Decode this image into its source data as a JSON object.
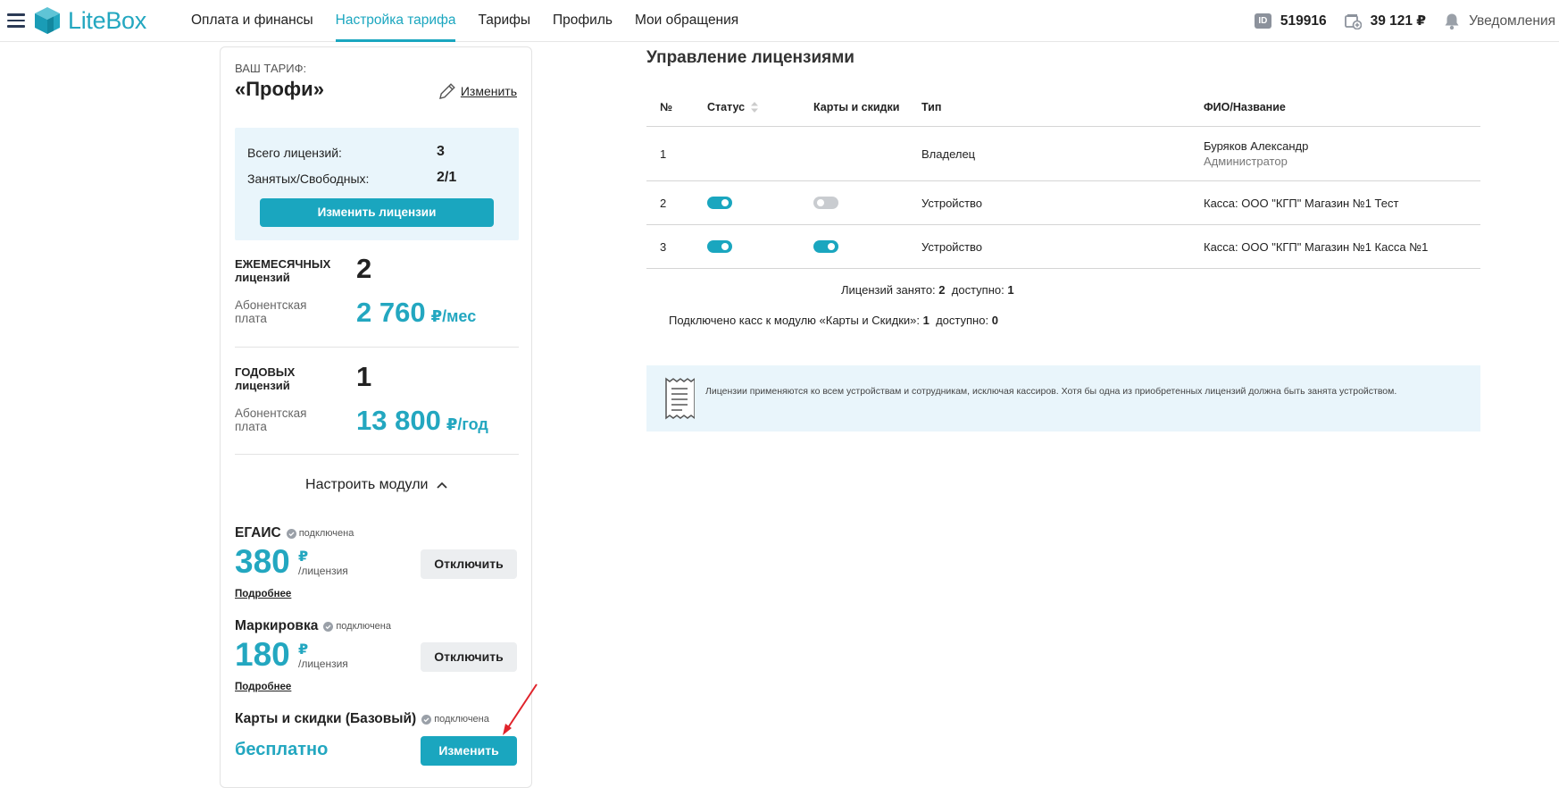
{
  "app": {
    "logo_text": "LiteBox"
  },
  "nav": [
    "Оплата и финансы",
    "Настройка тарифа",
    "Тарифы",
    "Профиль",
    "Мои обращения"
  ],
  "topright": {
    "id_badge": "ID",
    "account_id": "519916",
    "balance": "39 121 ₽",
    "notifications": "Уведомления"
  },
  "tariff": {
    "caption": "ВАШ ТАРИФ:",
    "name": "«Профи»",
    "edit_label": "Изменить",
    "total_label": "Всего лицензий:",
    "total_value": "3",
    "used_label": "Занятых/Свободных:",
    "used_value": "2/1",
    "change_licenses_label": "Изменить лицензии",
    "monthly": {
      "title": "ЕЖЕМЕСЯЧНЫХ лицензий",
      "count": "2",
      "fee_label": "Абонентская плата",
      "fee_value": "2 760",
      "fee_unit": "₽/мес"
    },
    "yearly": {
      "title": "ГОДОВЫХ лицензий",
      "count": "1",
      "fee_label": "Абонентская плата",
      "fee_value": "13 800",
      "fee_unit": "₽/год"
    },
    "modules_toggle": "Настроить модули",
    "modules": [
      {
        "name": "ЕГАИС",
        "status": "подключена",
        "price": "380",
        "currency": "₽",
        "per": "/лицензия",
        "more": "Подробнее",
        "action": "Отключить"
      },
      {
        "name": "Маркировка",
        "status": "подключена",
        "price": "180",
        "currency": "₽",
        "per": "/лицензия",
        "more": "Подробнее",
        "action": "Отключить"
      },
      {
        "name": "Карты и скидки (Базовый)",
        "status": "подключена",
        "price": "бесплатно",
        "action": "Изменить"
      }
    ]
  },
  "licenses": {
    "title": "Управление лицензиями",
    "columns": [
      "№",
      "Статус",
      "Карты и скидки",
      "Тип",
      "ФИО/Название"
    ],
    "rows": [
      {
        "num": "1",
        "status": null,
        "cards": null,
        "type": "Владелец",
        "name": "Буряков Александр",
        "role": "Администратор"
      },
      {
        "num": "2",
        "status": "on",
        "cards": "off",
        "type": "Устройство",
        "name": "Касса: ООО \"КГП\" Магазин №1 Тест"
      },
      {
        "num": "3",
        "status": "on",
        "cards": "on",
        "type": "Устройство",
        "name": "Касса: ООО \"КГП\" Магазин №1 Касса №1"
      }
    ],
    "summary_used_label": "Лицензий занято:",
    "summary_used": "2",
    "summary_free_label": "доступно:",
    "summary_free": "1",
    "summary_cards_label": "Подключено касс к модулю «Карты и Скидки»:",
    "summary_cards": "1",
    "summary_cards_free_label": "доступно:",
    "summary_cards_free": "0",
    "info_text": "Лицензии применяются ко всем устройствам и сотрудникам, исключая кассиров. Хотя бы одна из приобретенных лицензий должна быть занята устройством."
  },
  "colors": {
    "accent": "#1aa6bf",
    "info_bg": "#e9f5fb",
    "arrow": "#e0232b"
  }
}
